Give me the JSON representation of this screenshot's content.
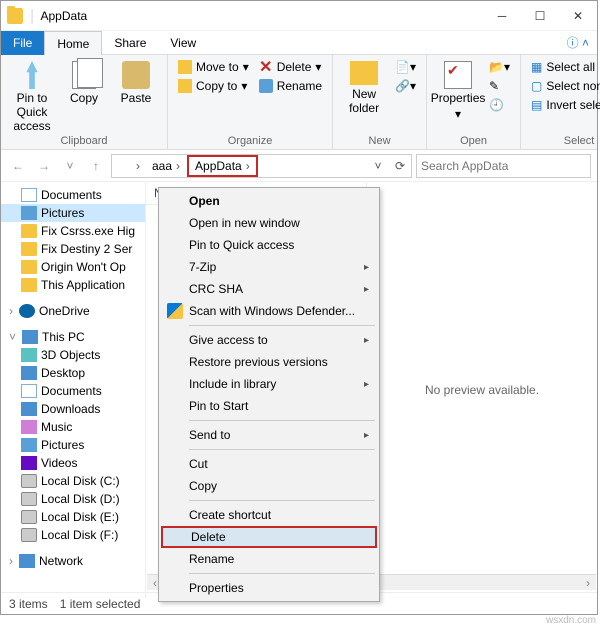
{
  "title": "AppData",
  "tabs": {
    "file": "File",
    "home": "Home",
    "share": "Share",
    "view": "View"
  },
  "ribbon": {
    "pin": "Pin to Quick access",
    "copy": "Copy",
    "paste": "Paste",
    "moveto": "Move to",
    "copyto": "Copy to",
    "delete": "Delete",
    "rename": "Rename",
    "newfolder": "New folder",
    "properties": "Properties",
    "selectall": "Select all",
    "selectnone": "Select none",
    "invert": "Invert selection",
    "grp_clipboard": "Clipboard",
    "grp_organize": "Organize",
    "grp_new": "New",
    "grp_open": "Open",
    "grp_select": "Select"
  },
  "breadcrumb": {
    "a": "aaa",
    "b": "AppData"
  },
  "search_placeholder": "Search AppData",
  "col_name": "Name",
  "nav": {
    "documents": "Documents",
    "pictures": "Pictures",
    "fixcsrs": "Fix Csrss.exe Hig",
    "fixdestiny": "Fix Destiny 2 Ser",
    "origin": "Origin Won't Op",
    "thisapp": "This Application",
    "onedrive": "OneDrive",
    "thispc": "This PC",
    "d3d": "3D Objects",
    "desktop": "Desktop",
    "documents2": "Documents",
    "downloads": "Downloads",
    "music": "Music",
    "pictures2": "Pictures",
    "videos": "Videos",
    "diskc": "Local Disk (C:)",
    "diskd": "Local Disk (D:)",
    "diske": "Local Disk (E:)",
    "diskf": "Local Disk (F:)",
    "network": "Network"
  },
  "preview_text": "No preview available.",
  "context": {
    "open": "Open",
    "open_new": "Open in new window",
    "pin_qa": "Pin to Quick access",
    "sevenzip": "7-Zip",
    "crc": "CRC SHA",
    "defender": "Scan with Windows Defender...",
    "give_access": "Give access to",
    "restore": "Restore previous versions",
    "include_lib": "Include in library",
    "pin_start": "Pin to Start",
    "sendto": "Send to",
    "cut": "Cut",
    "copy": "Copy",
    "shortcut": "Create shortcut",
    "delete": "Delete",
    "rename": "Rename",
    "properties": "Properties"
  },
  "status": {
    "items": "3 items",
    "selected": "1 item selected"
  },
  "watermark": "wsxdn.com"
}
